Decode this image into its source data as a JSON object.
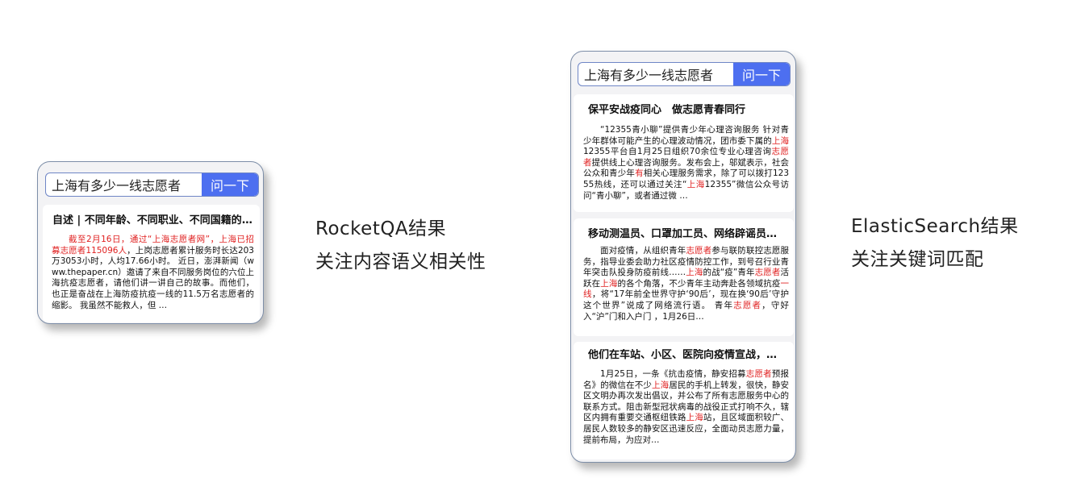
{
  "left_panel": {
    "search": {
      "value": "上海有多少一线志愿者",
      "button": "问一下"
    },
    "result": {
      "title": "自述 | 不同年龄、不同职业、不同国籍的他们为何选择做上海志愿者",
      "segments": [
        {
          "text": "截至2月16日，通过“上海志愿者网”，上海已招募志愿者115096人",
          "hl": true
        },
        {
          "text": "，上岗志愿者累计服务时长达203万3053小时，人均17.66小时。 近日，澎湃新闻（www.thepaper.cn）邀请了来自不同服务岗位的六位上海抗疫志愿者，请他们讲一讲自己的故事。而他们，也正是奋战在上海防疫抗疫一线的11.5万名志愿者的缩影。 我虽然不能救人，但 …",
          "hl": false
        }
      ]
    }
  },
  "left_caption": {
    "line1": "RocketQA结果",
    "line2": "关注内容语义相关性"
  },
  "right_panel": {
    "search": {
      "value": "上海有多少一线志愿者",
      "button": "问一下"
    },
    "results": [
      {
        "title": "保平安战疫同心　做志愿青春同行",
        "segments": [
          {
            "text": "“12355青小聊”提供青少年心理咨询服务 针对青少年群体可能产生的心理波动情况，团市委下属的",
            "hl": false
          },
          {
            "text": "上海",
            "hl": true
          },
          {
            "text": "12355平台自1月25日组织70余位专业心理咨询",
            "hl": false
          },
          {
            "text": "志愿者",
            "hl": true
          },
          {
            "text": "提供线上心理咨询服务。发布会上，邬斌表示，社会公众和青少年",
            "hl": false
          },
          {
            "text": "有",
            "hl": true
          },
          {
            "text": "相关心理服务需求，除了可以拨打12355热线，还可以通过关注“",
            "hl": false
          },
          {
            "text": "上海",
            "hl": true
          },
          {
            "text": "12355”微信公众号访问“青小聊”，或者通过微 …",
            "hl": false
          }
        ]
      },
      {
        "title": "移动测温员、口罩加工员、网络辟谣员……抗疫一线的青年志愿者",
        "segments": [
          {
            "text": "面对疫情，从组织青年",
            "hl": false
          },
          {
            "text": "志愿者",
            "hl": true
          },
          {
            "text": "参与联防联控志愿服务，指导业委会助力社区疫情防控工作，到号召行业青年突击队投身防疫前线……",
            "hl": false
          },
          {
            "text": "上海",
            "hl": true
          },
          {
            "text": "的战“疫”青年",
            "hl": false
          },
          {
            "text": "志愿者",
            "hl": true
          },
          {
            "text": "活跃在",
            "hl": false
          },
          {
            "text": "上海",
            "hl": true
          },
          {
            "text": "的各个角落，不少青年主动奔赴各领域抗疫",
            "hl": false
          },
          {
            "text": "一线",
            "hl": true
          },
          {
            "text": "，将“17年前全世界守护‘90后’，现在换‘90后’守护这个世界”说成了网络流行语。 青年",
            "hl": false
          },
          {
            "text": "志愿者",
            "hl": true
          },
          {
            "text": "，守好入“沪”门和入户门 ，1月26日…",
            "hl": false
          }
        ]
      },
      {
        "title": "他们在车站、小区、医院向疫情宣战，这群志愿者值得点赞",
        "segments": [
          {
            "text": "1月25日，一条《抗击疫情，静安招募",
            "hl": false
          },
          {
            "text": "志愿者",
            "hl": true
          },
          {
            "text": "预报名》的微信在不少",
            "hl": false
          },
          {
            "text": "上海",
            "hl": true
          },
          {
            "text": "居民的手机上转发，很快，静安区文明办再次发出倡议，并公布了所有志愿服务中心的联系方式。阻击新型冠状病毒的战役正式打响不久，辖区内拥有重要交通枢纽铁路",
            "hl": false
          },
          {
            "text": "上海",
            "hl": true
          },
          {
            "text": "站，且区域面积较广、居民人数较多的静安区迅速反应，全面动员志愿力量，提前布局，为应对…",
            "hl": false
          }
        ]
      }
    ]
  },
  "right_caption": {
    "line1": "ElasticSearch结果",
    "line2": "关注关键词匹配"
  },
  "colors": {
    "accent": "#4d6ff0",
    "highlight": "#e02020",
    "frame": "#7d8ea8"
  }
}
